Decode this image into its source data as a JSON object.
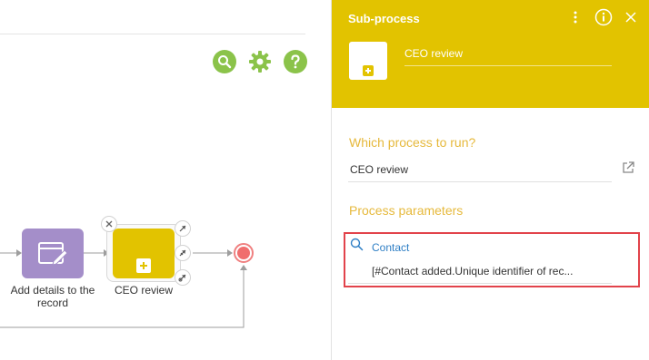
{
  "toolbar": {
    "search_icon": "search-icon",
    "settings_icon": "gear-icon",
    "help_icon": "help-icon",
    "icon_color": "#8bc34a"
  },
  "diagram": {
    "tasks": [
      {
        "label": "Add details to the record",
        "color": "#a48ec9",
        "icon": "edit-page-icon"
      },
      {
        "label": "CEO review",
        "color": "#e2c300",
        "icon": "subprocess-plus-icon"
      }
    ],
    "end_event_color": "#f06e6e",
    "connector_color": "#9e9e9e"
  },
  "panel": {
    "title": "Sub-process",
    "header_color": "#e2c300",
    "element_name": "CEO review",
    "process_section_label": "Which process to run?",
    "process_value": "CEO review",
    "parameters_section_label": "Process parameters",
    "parameters": [
      {
        "name": "Contact",
        "value": "[#Contact added.Unique identifier of rec..."
      }
    ],
    "highlight_color": "#e2434b",
    "accent_label_color": "#e6b93c",
    "parameter_name_color": "#2f7fc5"
  }
}
